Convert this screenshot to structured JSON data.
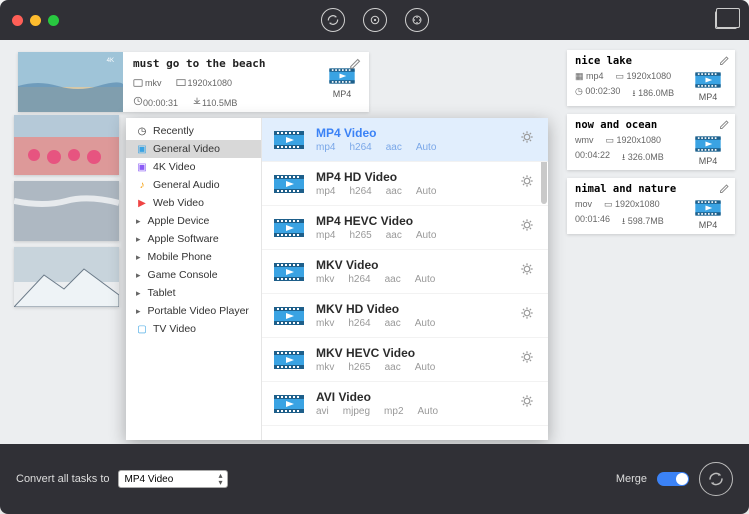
{
  "titlebar": {
    "icons": {
      "refresh": "refresh",
      "disc": "disc",
      "film": "film",
      "screens": "screens"
    }
  },
  "tasks": [
    {
      "title": "must go to the beach",
      "format": "mkv",
      "resolution": "1920x1080",
      "duration": "00:00:31",
      "size": "110.5MB",
      "output": "MP4",
      "thumb": "beach"
    },
    {
      "title": "nice lake",
      "format": "mp4",
      "resolution": "1920x1080",
      "duration": "00:02:30",
      "size": "186.0MB",
      "output": "MP4",
      "thumb": "lake"
    },
    {
      "title": "now﻿   and   ocean",
      "format": "wmv",
      "resolution": "1920x1080",
      "duration": "00:04:22",
      "size": "326.0MB",
      "output": "MP4",
      "thumb": "flamingo"
    },
    {
      "title": "nimal and nature",
      "format": "mov",
      "resolution": "1920x1080",
      "duration": "00:01:46",
      "size": "598.7MB",
      "output": "MP4",
      "thumb": "snow"
    }
  ],
  "sidebar": {
    "categories": [
      {
        "icon": "clock",
        "label": "Recently",
        "sub": false
      },
      {
        "icon": "film-b",
        "label": "General Video",
        "sub": false,
        "selected": true
      },
      {
        "icon": "4k",
        "label": "4K Video",
        "sub": false
      },
      {
        "icon": "audio",
        "label": "General Audio",
        "sub": false
      },
      {
        "icon": "yt",
        "label": "Web Video",
        "sub": false
      },
      {
        "icon": "",
        "label": "Apple Device",
        "sub": true
      },
      {
        "icon": "",
        "label": "Apple Software",
        "sub": true
      },
      {
        "icon": "",
        "label": "Mobile Phone",
        "sub": true
      },
      {
        "icon": "",
        "label": "Game Console",
        "sub": true
      },
      {
        "icon": "",
        "label": "Tablet",
        "sub": true
      },
      {
        "icon": "",
        "label": "Portable Video Player",
        "sub": true
      },
      {
        "icon": "tv",
        "label": "TV Video",
        "sub": false
      }
    ]
  },
  "formats": [
    {
      "name": "MP4 Video",
      "codecs": [
        "mp4",
        "h264",
        "aac",
        "Auto"
      ],
      "selected": true
    },
    {
      "name": "MP4 HD Video",
      "codecs": [
        "mp4",
        "h264",
        "aac",
        "Auto"
      ]
    },
    {
      "name": "MP4 HEVC Video",
      "codecs": [
        "mp4",
        "h265",
        "aac",
        "Auto"
      ]
    },
    {
      "name": "MKV Video",
      "codecs": [
        "mkv",
        "h264",
        "aac",
        "Auto"
      ]
    },
    {
      "name": "MKV HD Video",
      "codecs": [
        "mkv",
        "h264",
        "aac",
        "Auto"
      ]
    },
    {
      "name": "MKV HEVC Video",
      "codecs": [
        "mkv",
        "h265",
        "aac",
        "Auto"
      ]
    },
    {
      "name": "AVI Video",
      "codecs": [
        "avi",
        "mjpeg",
        "mp2",
        "Auto"
      ]
    }
  ],
  "footer": {
    "label": "Convert all tasks to",
    "selected": "MP4 Video",
    "merge_label": "Merge",
    "merge_on": true
  }
}
